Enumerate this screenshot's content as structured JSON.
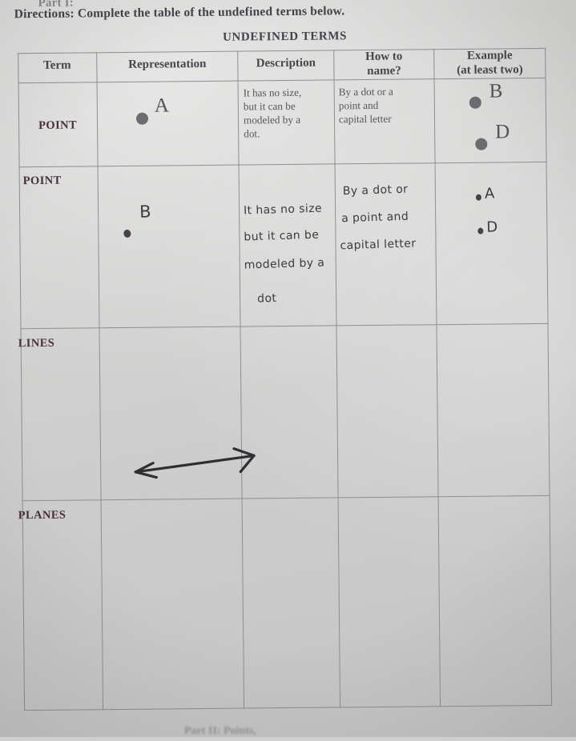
{
  "document": {
    "part_label": "Part I:",
    "directions": "Directions: Complete the table of the undefined terms below.",
    "table_title": "UNDEFINED TERMS",
    "bottom_cut_text": "Part II: Points,"
  },
  "table": {
    "headers": [
      {
        "line1": "Term",
        "line2": ""
      },
      {
        "line1": "Representation",
        "line2": ""
      },
      {
        "line1": "Description",
        "line2": ""
      },
      {
        "line1": "How to",
        "line2": "name?"
      },
      {
        "line1": "Example",
        "line2": "(at least two)"
      }
    ],
    "rows": [
      {
        "term": "POINT",
        "kind": "printed-example",
        "representation_label": "A",
        "description": "It has no size, but it can be modeled by a dot.",
        "description_lines": [
          "It has no size,",
          "but it can be",
          "modeled by a",
          "dot."
        ],
        "how_to_name": "By a dot or a point and capital letter",
        "how_to_name_lines": [
          "By a dot or a",
          "point and",
          "capital letter"
        ],
        "examples": [
          "B",
          "D"
        ]
      },
      {
        "term": "POINT",
        "kind": "handwritten-answer",
        "representation_label": "B",
        "description_lines": [
          "It has no size",
          "but it can be",
          "modeled by a",
          "dot"
        ],
        "how_to_name_lines": [
          "By a dot or",
          "a point and",
          "capital letter"
        ],
        "examples": [
          "A",
          "D"
        ]
      },
      {
        "term": "LINES",
        "kind": "handwritten-answer",
        "representation_drawing": "double-headed-arrow",
        "description_lines": [],
        "how_to_name_lines": [],
        "examples": []
      },
      {
        "term": "PLANES",
        "kind": "blank",
        "description_lines": [],
        "how_to_name_lines": [],
        "examples": []
      }
    ]
  },
  "colors": {
    "paper": "#d2d3d1",
    "rule": "#8d8f92",
    "printed_ink": "#5a545c",
    "handwriting_ink": "#3b3a40",
    "term_ink": "#4a2f3b"
  }
}
